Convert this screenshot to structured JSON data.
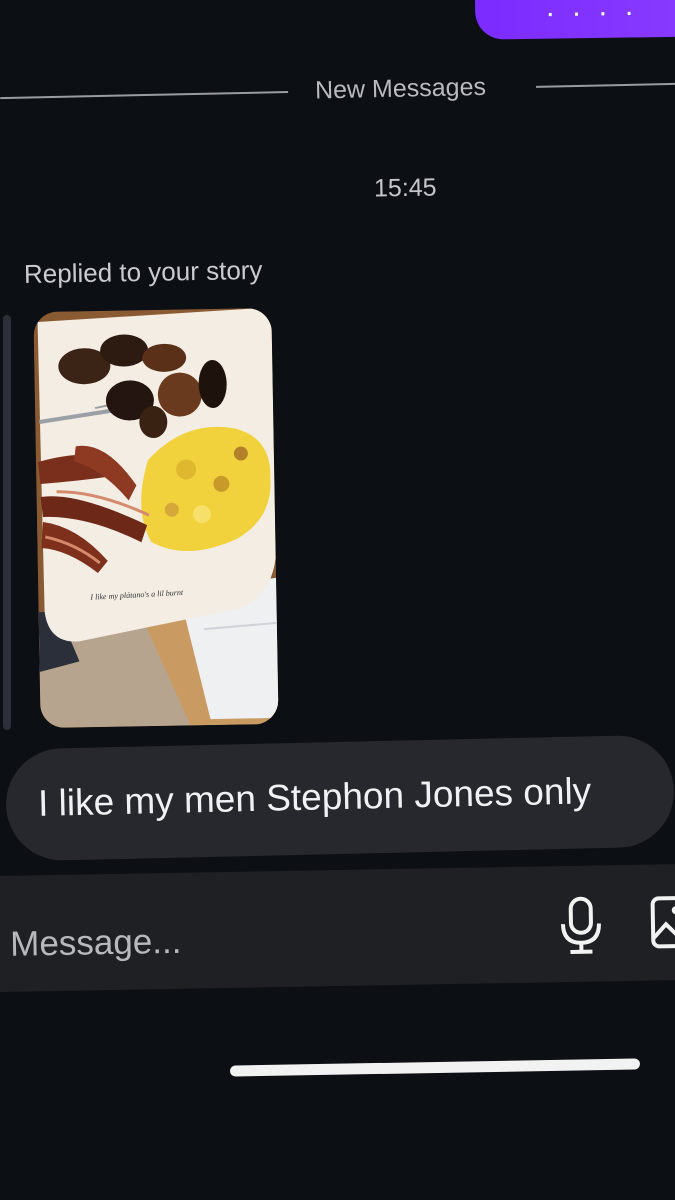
{
  "divider": {
    "label": "New Messages"
  },
  "thread": {
    "timestamp": "15:45",
    "reply_caption": "Replied to your story",
    "story_caption": "I like my plátano's a lil burnt",
    "received_message": "I like my men Stephon Jones only"
  },
  "composer": {
    "placeholder": "Message..."
  },
  "icons": {
    "mic": "microphone-icon",
    "gallery": "gallery-icon"
  },
  "colors": {
    "background": "#0c0f14",
    "sent_bubble": "#7b2bff",
    "received_bubble": "#26282d",
    "composer_bar": "#1f2024"
  }
}
